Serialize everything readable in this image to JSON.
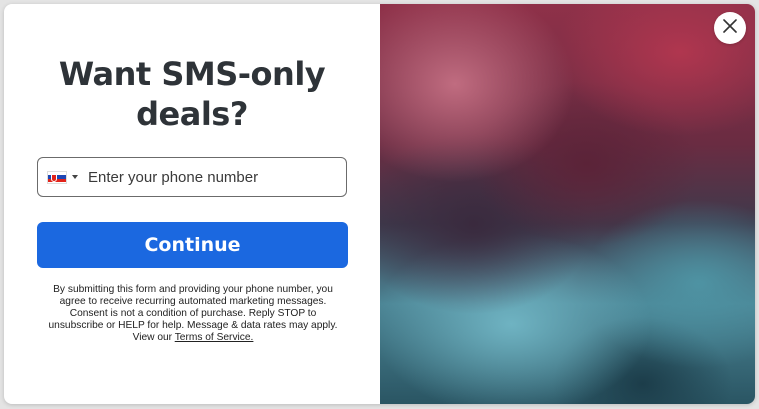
{
  "popup": {
    "headline": "Want SMS-only deals?",
    "phone": {
      "country_flag": "slovakia-flag",
      "placeholder": "Enter your phone number",
      "value": ""
    },
    "continue_label": "Continue",
    "disclaimer": {
      "text": "By submitting this form and providing your phone number, you agree to receive recurring automated marketing messages. Consent is not a condition of purchase. Reply STOP to unsubscribe or HELP for help. Message & data rates may apply. View our ",
      "link_label": "Terms of Service.",
      "link_punct": ""
    },
    "close_icon": "close-icon",
    "colors": {
      "button": "#1b68e0",
      "headline": "#2e3338"
    }
  }
}
